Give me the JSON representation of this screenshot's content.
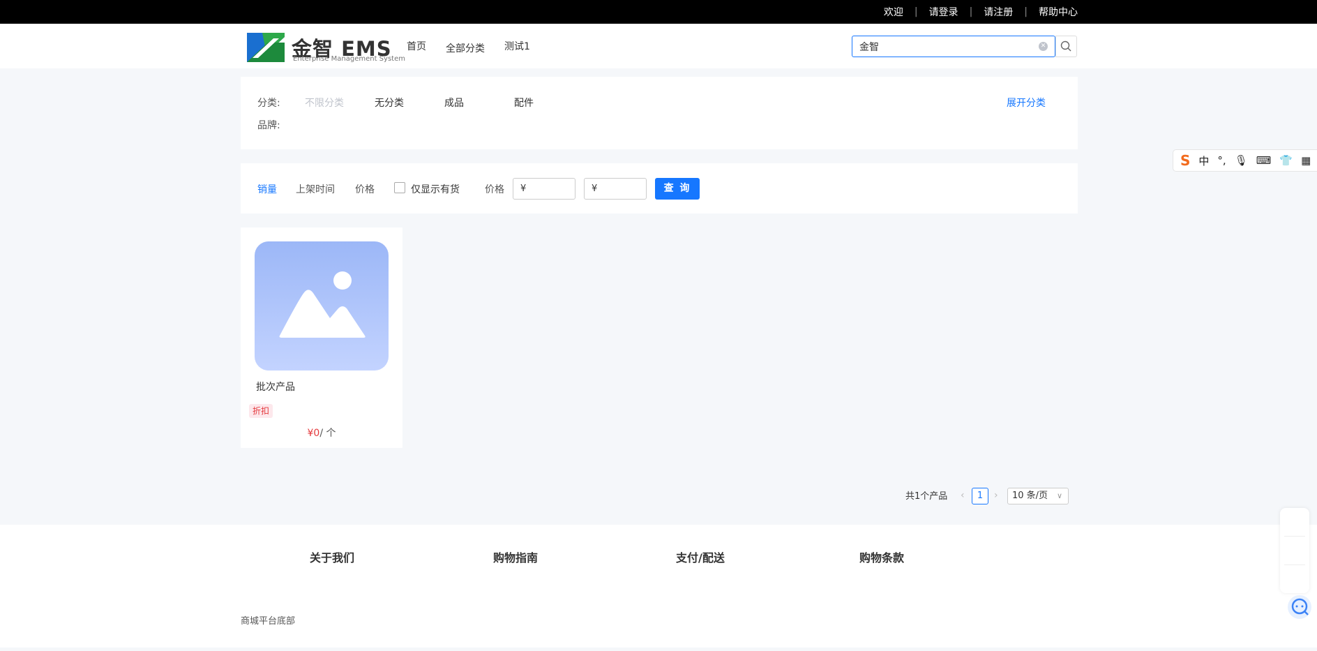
{
  "topbar": {
    "welcome": "欢迎",
    "login": "请登录",
    "register": "请注册",
    "help": "帮助中心",
    "separator": "|"
  },
  "header": {
    "logo_name": "金智 EMS",
    "logo_sub": "Enterprise Management System",
    "nav": [
      "首页",
      "全部分类",
      "测试1"
    ],
    "search_value": "金智",
    "search_icon": "search-icon"
  },
  "categories": {
    "label": "分类:",
    "items": [
      "不限分类",
      "无分类",
      "成品",
      "配件"
    ],
    "brand_label": "品牌:",
    "expand": "展开分类"
  },
  "filter": {
    "sort_sales": "销量",
    "sort_time": "上架时间",
    "sort_price": "价格",
    "in_stock_only": "仅显示有货",
    "price_label": "价格",
    "price_min_prefix": "¥",
    "price_max_prefix": "¥",
    "query": "查 询"
  },
  "products": [
    {
      "name": "批次产品",
      "tag": "折扣",
      "price": "¥0",
      "unit": "/ 个"
    }
  ],
  "pagination": {
    "total": "共1个产品",
    "current": "1",
    "page_size": "10 条/页"
  },
  "footer": {
    "columns": [
      "关于我们",
      "购物指南",
      "支付/配送",
      "购物条款"
    ],
    "bottom": "商城平台底部"
  },
  "ime": {
    "mode": "中",
    "punct": "°,"
  },
  "colors": {
    "accent": "#1677ff",
    "price": "#e4393c",
    "topbar": "#000000"
  }
}
